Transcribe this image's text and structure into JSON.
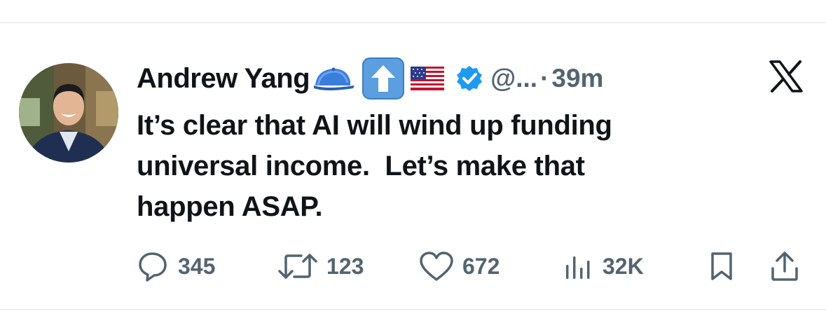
{
  "tweet": {
    "author_name": "Andrew Yang",
    "handle": "@...",
    "separator": "·",
    "time": "39m",
    "badges": [
      "blue-cap-emoji",
      "up-arrow-emoji",
      "us-flag-emoji",
      "verified-badge-icon"
    ],
    "text": "It’s clear that AI will wind up funding\nuniversal income.  Let’s make that\nhappen ASAP."
  },
  "metrics": {
    "replies": "345",
    "reposts": "123",
    "likes": "672",
    "views": "32K"
  },
  "icons": {
    "reply": "speech-bubble-icon",
    "repost": "repost-arrows-icon",
    "like": "heart-icon",
    "views": "bar-chart-icon",
    "bookmark": "bookmark-icon",
    "share": "share-upload-icon",
    "platform": "x-logo-icon"
  },
  "colors": {
    "text_primary": "#0f1419",
    "text_secondary": "#536471",
    "verified_blue": "#1d9bf0"
  }
}
